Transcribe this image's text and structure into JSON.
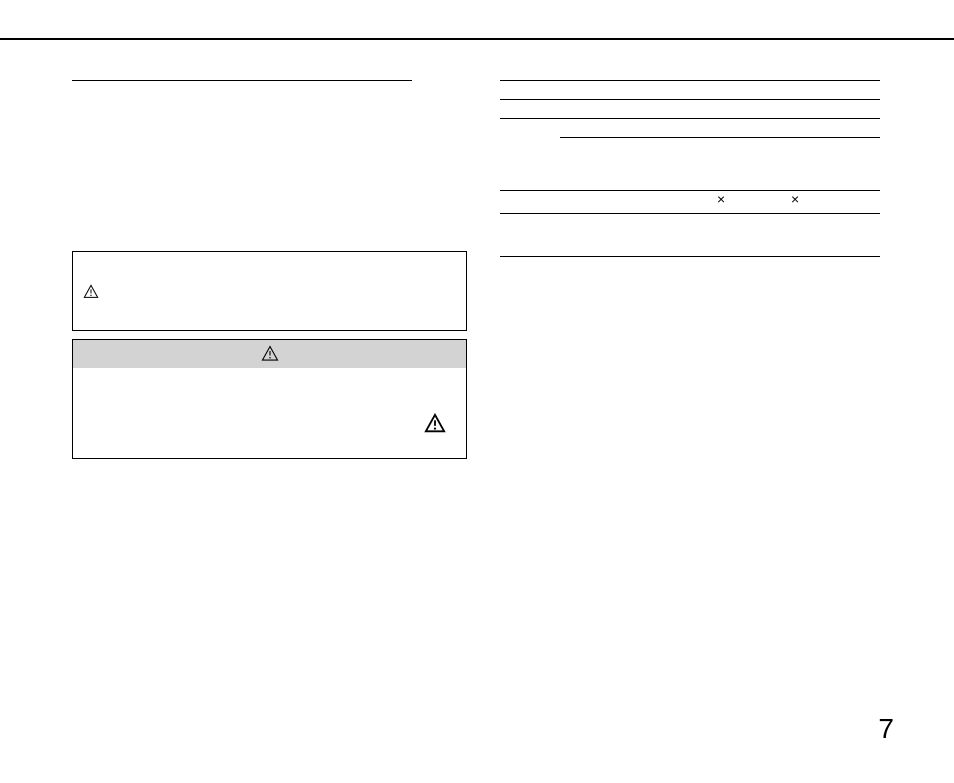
{
  "page_number": "7",
  "symbols": {
    "multiply_1": "×",
    "multiply_2": "×"
  }
}
